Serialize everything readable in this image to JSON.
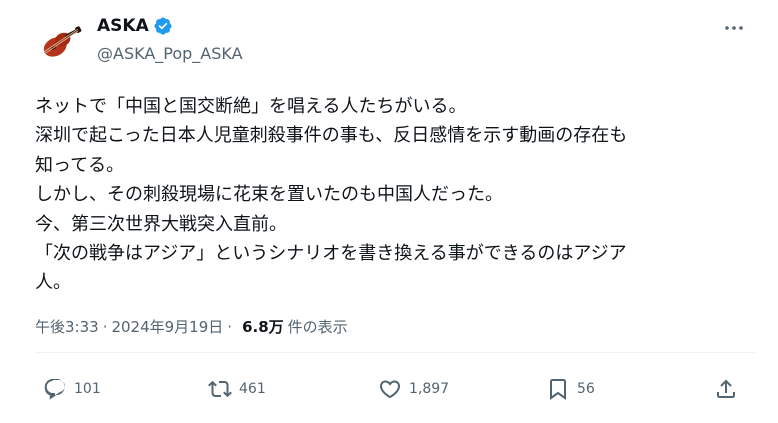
{
  "author": {
    "display_name": "ASKA",
    "handle": "@ASKA_Pop_ASKA"
  },
  "tweet": {
    "lines": [
      "ネットで「中国と国交断絶」を唱える人たちがいる。",
      "深圳で起こった日本人児童刺殺事件の事も、反日感情を示す動画の存在も",
      "知ってる。",
      "しかし、その刺殺現場に花束を置いたのも中国人だった。",
      "今、第三次世界大戦突入直前。",
      "「次の戦争はアジア」というシナリオを書き換える事ができるのはアジア",
      "人。"
    ],
    "time": "午後3:33",
    "separator": "·",
    "date": "2024年9月19日",
    "views_count": "6.8万",
    "views_label": "件の表示"
  },
  "actions": {
    "replies": "101",
    "reposts": "461",
    "likes": "1,897",
    "bookmarks": "56"
  },
  "icons": {
    "avatar": "violin-avatar",
    "verified": "verified-badge-icon",
    "more": "more-dots-icon",
    "reply": "reply-icon",
    "repost": "repost-icon",
    "like": "heart-icon",
    "bookmark": "bookmark-icon",
    "share": "share-icon"
  },
  "colors": {
    "text": "#0f1419",
    "secondary": "#536471",
    "verified": "#1d9bf0",
    "divider": "#eff3f4"
  }
}
